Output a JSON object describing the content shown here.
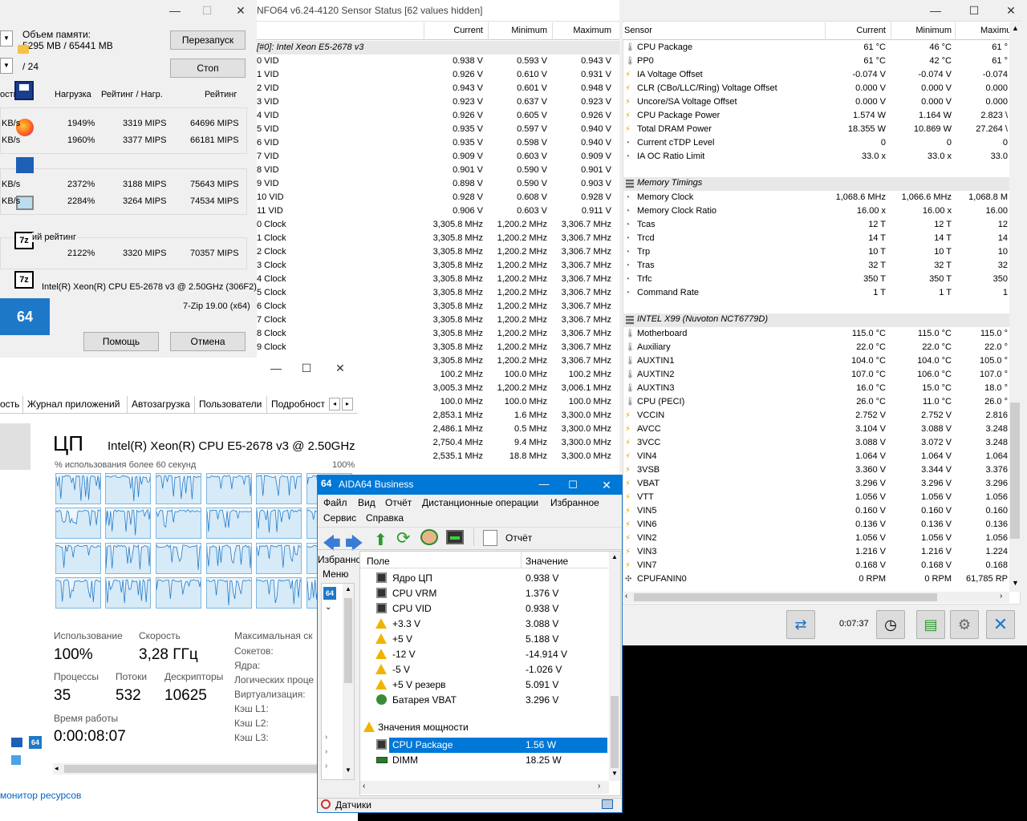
{
  "sensor_panel": {
    "title": "NFO64 v6.24-4120 Sensor Status [62 values hidden]",
    "headers": {
      "current": "Current",
      "min": "Minimum",
      "max": "Maximum"
    },
    "group": "[#0]: Intel Xeon E5-2678 v3",
    "rows": [
      [
        "0 VID",
        "0.938 V",
        "0.593 V",
        "0.943 V"
      ],
      [
        "1 VID",
        "0.926 V",
        "0.610 V",
        "0.931 V"
      ],
      [
        "2 VID",
        "0.943 V",
        "0.601 V",
        "0.948 V"
      ],
      [
        "3 VID",
        "0.923 V",
        "0.637 V",
        "0.923 V"
      ],
      [
        "4 VID",
        "0.926 V",
        "0.605 V",
        "0.926 V"
      ],
      [
        "5 VID",
        "0.935 V",
        "0.597 V",
        "0.940 V"
      ],
      [
        "6 VID",
        "0.935 V",
        "0.598 V",
        "0.940 V"
      ],
      [
        "7 VID",
        "0.909 V",
        "0.603 V",
        "0.909 V"
      ],
      [
        "8 VID",
        "0.901 V",
        "0.590 V",
        "0.901 V"
      ],
      [
        "9 VID",
        "0.898 V",
        "0.590 V",
        "0.903 V"
      ],
      [
        "10 VID",
        "0.928 V",
        "0.608 V",
        "0.928 V"
      ],
      [
        "11 VID",
        "0.906 V",
        "0.603 V",
        "0.911 V"
      ],
      [
        "0 Clock",
        "3,305.8 MHz",
        "1,200.2 MHz",
        "3,306.7 MHz"
      ],
      [
        "1 Clock",
        "3,305.8 MHz",
        "1,200.2 MHz",
        "3,306.7 MHz"
      ],
      [
        "2 Clock",
        "3,305.8 MHz",
        "1,200.2 MHz",
        "3,306.7 MHz"
      ],
      [
        "3 Clock",
        "3,305.8 MHz",
        "1,200.2 MHz",
        "3,306.7 MHz"
      ],
      [
        "4 Clock",
        "3,305.8 MHz",
        "1,200.2 MHz",
        "3,306.7 MHz"
      ],
      [
        "5 Clock",
        "3,305.8 MHz",
        "1,200.2 MHz",
        "3,306.7 MHz"
      ],
      [
        "6 Clock",
        "3,305.8 MHz",
        "1,200.2 MHz",
        "3,306.7 MHz"
      ],
      [
        "7 Clock",
        "3,305.8 MHz",
        "1,200.2 MHz",
        "3,306.7 MHz"
      ],
      [
        "8 Clock",
        "3,305.8 MHz",
        "1,200.2 MHz",
        "3,306.7 MHz"
      ],
      [
        "9 Clock",
        "3,305.8 MHz",
        "1,200.2 MHz",
        "3,306.7 MHz"
      ],
      [
        "",
        "3,305.8 MHz",
        "1,200.2 MHz",
        "3,306.7 MHz"
      ],
      [
        "",
        "100.2 MHz",
        "100.0 MHz",
        "100.2 MHz"
      ],
      [
        "",
        "3,005.3 MHz",
        "1,200.2 MHz",
        "3,006.1 MHz"
      ],
      [
        "",
        "100.0 MHz",
        "100.0 MHz",
        "100.0 MHz"
      ],
      [
        "",
        "2,853.1 MHz",
        "1.6 MHz",
        "3,300.0 MHz"
      ],
      [
        "",
        "2,486.1 MHz",
        "0.5 MHz",
        "3,300.0 MHz"
      ],
      [
        "",
        "2,750.4 MHz",
        "9.4 MHz",
        "3,300.0 MHz"
      ],
      [
        "",
        "2,535.1 MHz",
        "18.8 MHz",
        "3,300.0 MHz"
      ]
    ]
  },
  "sensor_right": {
    "headers": {
      "sensor": "Sensor",
      "current": "Current",
      "min": "Minimum",
      "max": "Maximu"
    },
    "rows": [
      {
        "t": "therm",
        "n": "CPU Package",
        "c": "61 °C",
        "mi": "46 °C",
        "ma": "61 °"
      },
      {
        "t": "therm",
        "n": "PP0",
        "c": "61 °C",
        "mi": "42 °C",
        "ma": "61 °"
      },
      {
        "t": "bolt",
        "n": "IA Voltage Offset",
        "c": "-0.074 V",
        "mi": "-0.074 V",
        "ma": "-0.074"
      },
      {
        "t": "bolt",
        "n": "CLR (CBo/LLC/Ring) Voltage Offset",
        "c": "0.000 V",
        "mi": "0.000 V",
        "ma": "0.000"
      },
      {
        "t": "bolt",
        "n": "Uncore/SA Voltage Offset",
        "c": "0.000 V",
        "mi": "0.000 V",
        "ma": "0.000"
      },
      {
        "t": "bolt",
        "n": "CPU Package Power",
        "c": "1.574 W",
        "mi": "1.164 W",
        "ma": "2.823 \\"
      },
      {
        "t": "bolt",
        "n": "Total DRAM Power",
        "c": "18.355 W",
        "mi": "10.869 W",
        "ma": "27.264 \\"
      },
      {
        "t": "clock",
        "n": "Current cTDP Level",
        "c": "0",
        "mi": "0",
        "ma": "0"
      },
      {
        "t": "clock",
        "n": "IA OC Ratio Limit",
        "c": "33.0 x",
        "mi": "33.0 x",
        "ma": "33.0"
      },
      {
        "t": "blank"
      },
      {
        "t": "group",
        "n": "Memory Timings"
      },
      {
        "t": "clock",
        "n": "Memory Clock",
        "c": "1,068.6 MHz",
        "mi": "1,066.6 MHz",
        "ma": "1,068.8 M"
      },
      {
        "t": "clock",
        "n": "Memory Clock Ratio",
        "c": "16.00 x",
        "mi": "16.00 x",
        "ma": "16.00"
      },
      {
        "t": "clock",
        "n": "Tcas",
        "c": "12 T",
        "mi": "12 T",
        "ma": "12"
      },
      {
        "t": "clock",
        "n": "Trcd",
        "c": "14 T",
        "mi": "14 T",
        "ma": "14"
      },
      {
        "t": "clock",
        "n": "Trp",
        "c": "10 T",
        "mi": "10 T",
        "ma": "10"
      },
      {
        "t": "clock",
        "n": "Tras",
        "c": "32 T",
        "mi": "32 T",
        "ma": "32"
      },
      {
        "t": "clock",
        "n": "Trfc",
        "c": "350 T",
        "mi": "350 T",
        "ma": "350"
      },
      {
        "t": "clock",
        "n": "Command Rate",
        "c": "1 T",
        "mi": "1 T",
        "ma": "1"
      },
      {
        "t": "blank"
      },
      {
        "t": "group",
        "n": "INTEL X99 (Nuvoton NCT6779D)"
      },
      {
        "t": "therm",
        "n": "Motherboard",
        "c": "115.0 °C",
        "mi": "115.0 °C",
        "ma": "115.0 °"
      },
      {
        "t": "therm",
        "n": "Auxiliary",
        "c": "22.0 °C",
        "mi": "22.0 °C",
        "ma": "22.0 °"
      },
      {
        "t": "therm",
        "n": "AUXTIN1",
        "c": "104.0 °C",
        "mi": "104.0 °C",
        "ma": "105.0 °"
      },
      {
        "t": "therm",
        "n": "AUXTIN2",
        "c": "107.0 °C",
        "mi": "106.0 °C",
        "ma": "107.0 °"
      },
      {
        "t": "therm",
        "n": "AUXTIN3",
        "c": "16.0 °C",
        "mi": "15.0 °C",
        "ma": "18.0 °"
      },
      {
        "t": "therm",
        "n": "CPU (PECI)",
        "c": "26.0 °C",
        "mi": "11.0 °C",
        "ma": "26.0 °"
      },
      {
        "t": "bolt",
        "n": "VCCIN",
        "c": "2.752 V",
        "mi": "2.752 V",
        "ma": "2.816"
      },
      {
        "t": "bolt",
        "n": "AVCC",
        "c": "3.104 V",
        "mi": "3.088 V",
        "ma": "3.248"
      },
      {
        "t": "bolt",
        "n": "3VCC",
        "c": "3.088 V",
        "mi": "3.072 V",
        "ma": "3.248"
      },
      {
        "t": "bolt",
        "n": "VIN4",
        "c": "1.064 V",
        "mi": "1.064 V",
        "ma": "1.064"
      },
      {
        "t": "bolt",
        "n": "3VSB",
        "c": "3.360 V",
        "mi": "3.344 V",
        "ma": "3.376"
      },
      {
        "t": "bolt",
        "n": "VBAT",
        "c": "3.296 V",
        "mi": "3.296 V",
        "ma": "3.296"
      },
      {
        "t": "bolt",
        "n": "VTT",
        "c": "1.056 V",
        "mi": "1.056 V",
        "ma": "1.056"
      },
      {
        "t": "bolt",
        "n": "VIN5",
        "c": "0.160 V",
        "mi": "0.160 V",
        "ma": "0.160"
      },
      {
        "t": "bolt",
        "n": "VIN6",
        "c": "0.136 V",
        "mi": "0.136 V",
        "ma": "0.136"
      },
      {
        "t": "bolt",
        "n": "VIN2",
        "c": "1.056 V",
        "mi": "1.056 V",
        "ma": "1.056"
      },
      {
        "t": "bolt",
        "n": "VIN3",
        "c": "1.216 V",
        "mi": "1.216 V",
        "ma": "1.224"
      },
      {
        "t": "bolt",
        "n": "VIN7",
        "c": "0.168 V",
        "mi": "0.168 V",
        "ma": "0.168"
      },
      {
        "t": "fan",
        "n": "CPUFANIN0",
        "c": "0 RPM",
        "mi": "0 RPM",
        "ma": "61,785 RP"
      }
    ],
    "elapsed": "0:07:37"
  },
  "zip": {
    "memory_label": "Объем памяти:",
    "memory_value": "5295 MB / 65441 MB",
    "threads": "/ 24",
    "restart": "Перезапуск",
    "stop": "Стоп",
    "col_load": "Нагрузка",
    "col_rating_load": "Рейтинг / Нагр.",
    "col_rating": "Рейтинг",
    "col_speed_cut": "ость",
    "rows": [
      {
        "u": "KB/s",
        "a": "1949%",
        "b": "3319 MIPS",
        "c": "64696 MIPS"
      },
      {
        "u": "KB/s",
        "a": "1960%",
        "b": "3377 MIPS",
        "c": "66181 MIPS"
      },
      {
        "u": "KB/s",
        "a": "2372%",
        "b": "3188 MIPS",
        "c": "75643 MIPS"
      },
      {
        "u": "KB/s",
        "a": "2284%",
        "b": "3264 MIPS",
        "c": "74534 MIPS"
      }
    ],
    "total_label": "ий рейтинг",
    "total": {
      "a": "2122%",
      "b": "3320 MIPS",
      "c": "70357 MIPS"
    },
    "cpu": "Intel(R) Xeon(R) CPU E5-2678 v3 @ 2.50GHz (306F2)",
    "version": "7-Zip 19.00 (x64)",
    "help": "Помощь",
    "cancel": "Отмена"
  },
  "taskmgr": {
    "tabs": [
      "ость",
      "Журнал приложений",
      "Автозагрузка",
      "Пользователи",
      "Подробност"
    ],
    "cpu_title": "ЦП",
    "cpu_name": "Intel(R) Xeon(R) CPU E5-2678 v3 @ 2.50GHz",
    "util_label": "% использования более 60 секунд",
    "util_max": "100%",
    "usage_label": "Использование",
    "usage_value": "100%",
    "speed_label": "Скорость",
    "speed_value": "3,28 ГГц",
    "proc_label": "Процессы",
    "proc_value": "35",
    "threads_label": "Потоки",
    "threads_value": "532",
    "handles_label": "Дескрипторы",
    "handles_value": "10625",
    "uptime_label": "Время работы",
    "uptime_value": "0:00:08:07",
    "right_labels": [
      "Максимальная ск",
      "Сокетов:",
      "Ядра:",
      "Логических проце",
      "Виртуализация:",
      "Кэш L1:",
      "Кэш L2:",
      "Кэш L3:"
    ],
    "monitor_link": "монитор ресурсов"
  },
  "aida": {
    "icon_text": "64",
    "title": "AIDA64 Business",
    "menu": [
      "Файл",
      "Вид",
      "Отчёт",
      "Дистанционные операции",
      "Избранное",
      "Сервис",
      "Справка"
    ],
    "report": "Отчёт",
    "left_tabs": [
      "Избранно",
      "Меню"
    ],
    "col_field": "Поле",
    "col_value": "Значение",
    "rows": [
      {
        "t": "chip",
        "n": "Ядро ЦП",
        "v": "0.938 V"
      },
      {
        "t": "chip",
        "n": "CPU VRM",
        "v": "1.376 V"
      },
      {
        "t": "chip",
        "n": "CPU VID",
        "v": "0.938 V"
      },
      {
        "t": "warn",
        "n": "+3.3 V",
        "v": "3.088 V"
      },
      {
        "t": "warn",
        "n": "+5 V",
        "v": "5.188 V"
      },
      {
        "t": "warn",
        "n": "-12 V",
        "v": "-14.914 V"
      },
      {
        "t": "warn",
        "n": "-5 V",
        "v": "-1.026 V"
      },
      {
        "t": "warn",
        "n": "+5 V резерв",
        "v": "5.091 V"
      },
      {
        "t": "bat",
        "n": "Батарея VBAT",
        "v": "3.296 V"
      }
    ],
    "power_group": "Значения мощности",
    "power_rows": [
      {
        "t": "chip",
        "n": "CPU Package",
        "v": "1.56 W",
        "sel": true
      },
      {
        "t": "dimm",
        "n": "DIMM",
        "v": "18.25 W",
        "sel": false
      }
    ],
    "status": "Датчики"
  },
  "colors": {
    "accent": "#0078d7",
    "graph": "#1e78c8",
    "selection": "#0078d7"
  }
}
